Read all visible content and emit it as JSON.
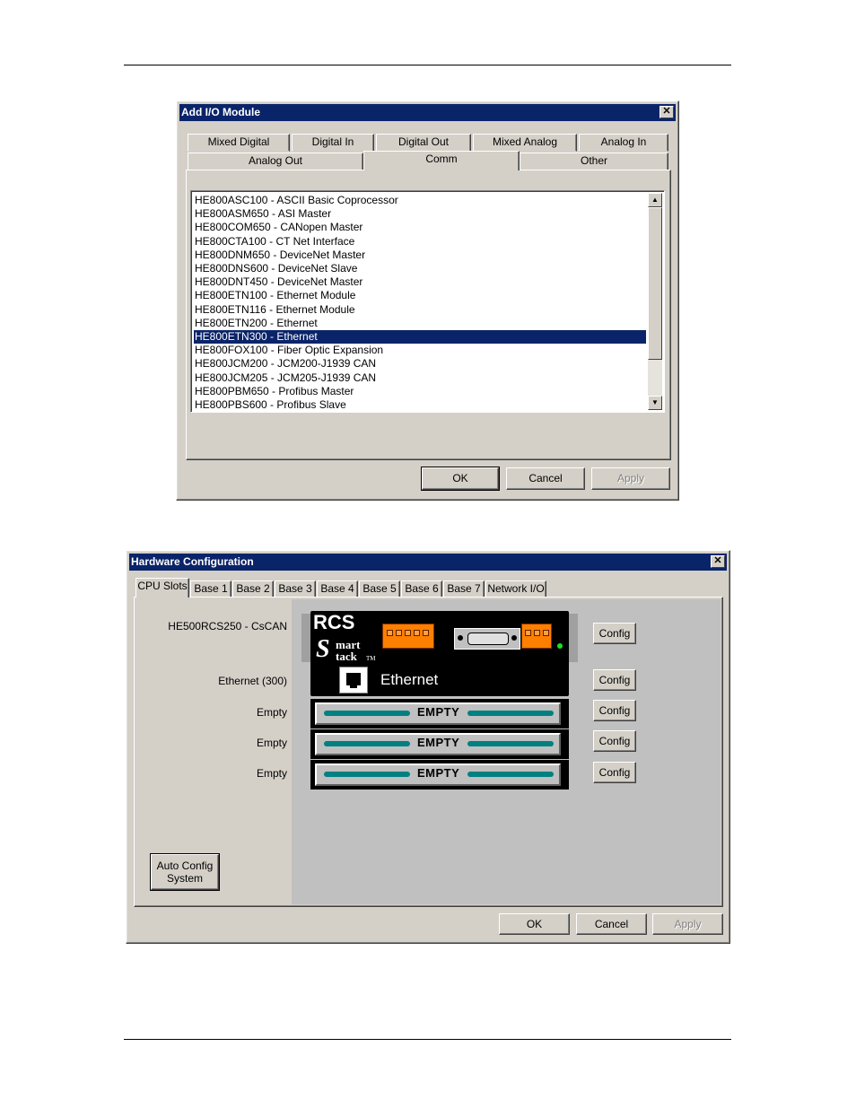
{
  "add_io_dialog": {
    "title": "Add I/O Module",
    "tabs_row1": [
      "Mixed Digital",
      "Digital In",
      "Digital Out",
      "Mixed Analog",
      "Analog In"
    ],
    "tabs_row2": [
      "Analog Out",
      "Comm",
      "Other"
    ],
    "active_tab": "Comm",
    "modules": [
      "HE800ASC100  -  ASCII Basic Coprocessor",
      "HE800ASM650  -  ASI Master",
      "HE800COM650  -  CANopen Master",
      "HE800CTA100  -  CT Net Interface",
      "HE800DNM650  -  DeviceNet Master",
      "HE800DNS600  -  DeviceNet Slave",
      "HE800DNT450  -  DeviceNet Master",
      "HE800ETN100  -  Ethernet Module",
      "HE800ETN116  -  Ethernet Module",
      "HE800ETN200  -  Ethernet",
      "HE800ETN300  -  Ethernet",
      "HE800FOX100  -  Fiber Optic Expansion",
      "HE800JCM200  -  JCM200-J1939 CAN",
      "HE800JCM205  -  JCM205-J1939 CAN",
      "HE800PBM650  -  Profibus Master",
      "HE800PBS600  -  Profibus Slave"
    ],
    "selected_index": 10,
    "ok_label": "OK",
    "cancel_label": "Cancel",
    "apply_label": "Apply"
  },
  "hw_config_dialog": {
    "title": "Hardware Configuration",
    "tabs": [
      "CPU Slots",
      "Base 1",
      "Base 2",
      "Base 3",
      "Base 4",
      "Base 5",
      "Base 6",
      "Base 7",
      "Network I/O"
    ],
    "active_tab": "CPU Slots",
    "slots": [
      {
        "label": "HE500RCS250 - CsCAN",
        "config": "Config"
      },
      {
        "label": "Ethernet (300)",
        "config": "Config"
      },
      {
        "label": "Empty",
        "config": "Config"
      },
      {
        "label": "Empty",
        "config": "Config"
      },
      {
        "label": "Empty",
        "config": "Config"
      }
    ],
    "cpu_brand": "RCS",
    "logo_line1": "mart",
    "logo_line2": "tack",
    "logo_tm": "TM",
    "logo_s": "S",
    "ethernet_module_label": "Ethernet",
    "empty_slot_text": "EMPTY",
    "auto_config_line1": "Auto Config",
    "auto_config_line2": "System",
    "ok_label": "OK",
    "cancel_label": "Cancel",
    "apply_label": "Apply"
  }
}
